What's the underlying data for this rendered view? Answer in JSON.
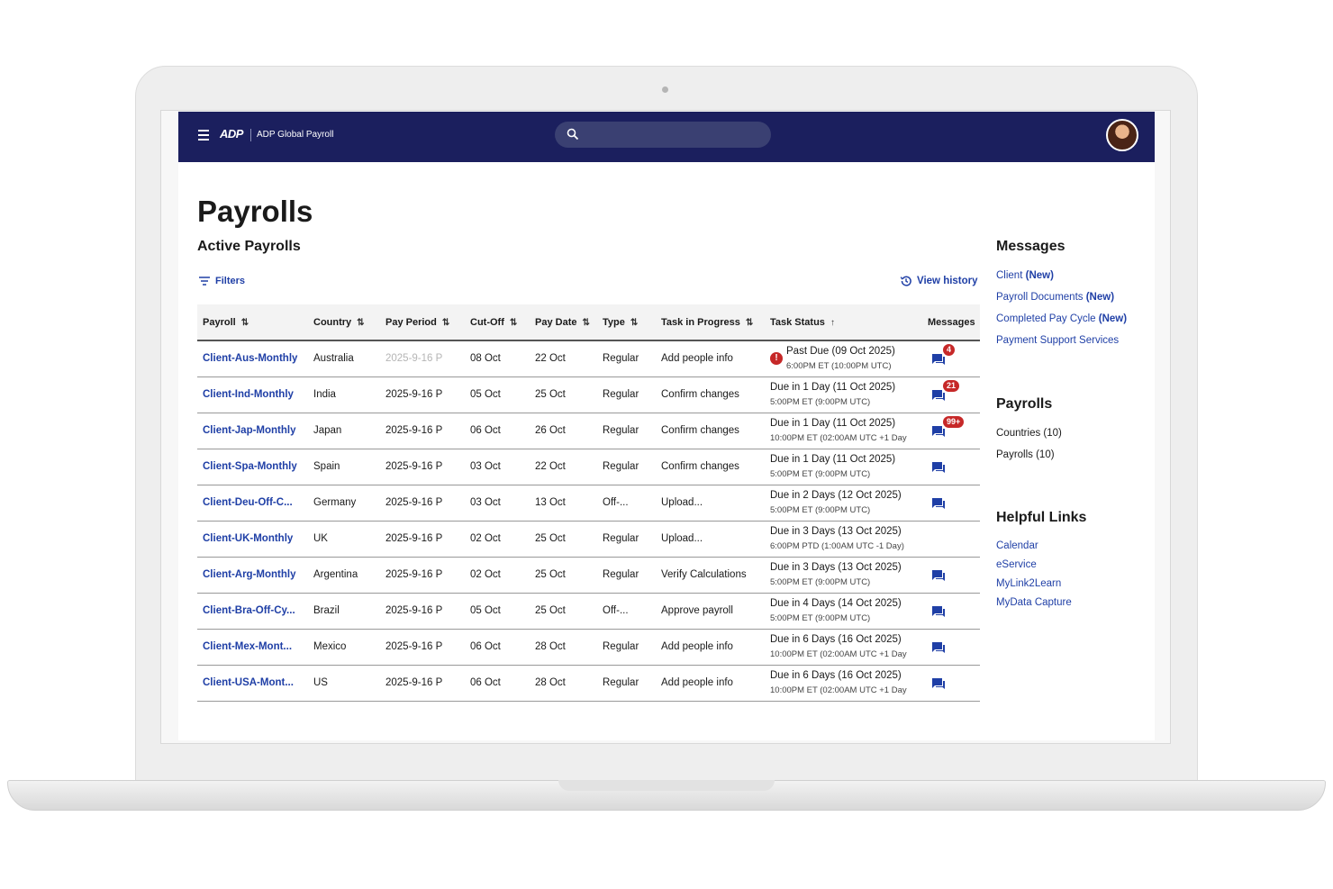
{
  "header": {
    "logo_text": "ADP",
    "app_title": "ADP Global Payroll",
    "search": {
      "placeholder": ""
    }
  },
  "page": {
    "title": "Payrolls",
    "section_title": "Active Payrolls",
    "filters_label": "Filters",
    "view_history_label": "View history"
  },
  "table": {
    "columns": [
      "Payroll",
      "Country",
      "Pay Period",
      "Cut-Off",
      "Pay Date",
      "Type",
      "Task in Progress",
      "Task Status",
      "Messages"
    ],
    "rows": [
      {
        "payroll": "Client-Aus-Monthly",
        "country": "Australia",
        "pay_period": "2025-9-16 P",
        "cut_off": "08 Oct",
        "pay_date": "22 Oct",
        "type": "Regular",
        "task": "Add people info",
        "status": "Past Due (09 Oct 2025)",
        "status_time": "6:00PM ET (10:00PM UTC)",
        "alert": true,
        "messages": "4",
        "has_msg": true,
        "period_muted": true
      },
      {
        "payroll": "Client-Ind-Monthly",
        "country": "India",
        "pay_period": "2025-9-16 P",
        "cut_off": "05 Oct",
        "pay_date": "25 Oct",
        "type": "Regular",
        "task": "Confirm changes",
        "status": "Due in 1 Day (11 Oct 2025)",
        "status_time": "5:00PM ET (9:00PM UTC)",
        "alert": false,
        "messages": "21",
        "has_msg": true
      },
      {
        "payroll": "Client-Jap-Monthly",
        "country": "Japan",
        "pay_period": "2025-9-16 P",
        "cut_off": "06 Oct",
        "pay_date": "26 Oct",
        "type": "Regular",
        "task": "Confirm changes",
        "status": "Due in 1 Day (11 Oct 2025)",
        "status_time": "10:00PM ET (02:00AM UTC +1 Day",
        "alert": false,
        "messages": "99+",
        "has_msg": true
      },
      {
        "payroll": "Client-Spa-Monthly",
        "country": "Spain",
        "pay_period": "2025-9-16 P",
        "cut_off": "03 Oct",
        "pay_date": "22 Oct",
        "type": "Regular",
        "task": "Confirm changes",
        "status": "Due in 1 Day (11 Oct 2025)",
        "status_time": "5:00PM ET (9:00PM UTC)",
        "alert": false,
        "messages": "",
        "has_msg": true
      },
      {
        "payroll": "Client-Deu-Off-C...",
        "country": "Germany",
        "pay_period": "2025-9-16 P",
        "cut_off": "03 Oct",
        "pay_date": "13 Oct",
        "type": "Off-...",
        "task": "Upload...",
        "status": "Due in 2 Days (12 Oct 2025)",
        "status_time": "5:00PM ET (9:00PM UTC)",
        "alert": false,
        "messages": "",
        "has_msg": true
      },
      {
        "payroll": "Client-UK-Monthly",
        "country": "UK",
        "pay_period": "2025-9-16 P",
        "cut_off": "02 Oct",
        "pay_date": "25 Oct",
        "type": "Regular",
        "task": "Upload...",
        "status": "Due in 3 Days (13 Oct 2025)",
        "status_time": "6:00PM PTD (1:00AM UTC -1 Day)",
        "alert": false,
        "messages": "",
        "has_msg": false
      },
      {
        "payroll": "Client-Arg-Monthly",
        "country": "Argentina",
        "pay_period": "2025-9-16 P",
        "cut_off": "02 Oct",
        "pay_date": "25 Oct",
        "type": "Regular",
        "task": "Verify Calculations",
        "status": "Due in 3 Days (13 Oct 2025)",
        "status_time": "5:00PM ET (9:00PM UTC)",
        "alert": false,
        "messages": "",
        "has_msg": true
      },
      {
        "payroll": "Client-Bra-Off-Cy...",
        "country": "Brazil",
        "pay_period": "2025-9-16 P",
        "cut_off": "05 Oct",
        "pay_date": "25 Oct",
        "type": "Off-...",
        "task": "Approve payroll",
        "status": "Due in 4 Days (14 Oct 2025)",
        "status_time": "5:00PM ET (9:00PM UTC)",
        "alert": false,
        "messages": "",
        "has_msg": true
      },
      {
        "payroll": "Client-Mex-Mont...",
        "country": "Mexico",
        "pay_period": "2025-9-16 P",
        "cut_off": "06 Oct",
        "pay_date": "28 Oct",
        "type": "Regular",
        "task": "Add people info",
        "status": "Due in 6 Days (16 Oct 2025)",
        "status_time": "10:00PM ET (02:00AM UTC +1 Day",
        "alert": false,
        "messages": "",
        "has_msg": true
      },
      {
        "payroll": "Client-USA-Mont...",
        "country": "US",
        "pay_period": "2025-9-16 P",
        "cut_off": "06 Oct",
        "pay_date": "28 Oct",
        "type": "Regular",
        "task": "Add people info",
        "status": "Due in 6 Days (16 Oct 2025)",
        "status_time": "10:00PM ET (02:00AM UTC +1 Day",
        "alert": false,
        "messages": "",
        "has_msg": true
      }
    ]
  },
  "sidebar": {
    "messages_title": "Messages",
    "message_links": [
      {
        "text": "Client ",
        "tag": "(New)"
      },
      {
        "text": "Payroll Documents ",
        "tag": "(New)"
      },
      {
        "text": "Completed Pay Cycle ",
        "tag": "(New)"
      },
      {
        "text": "Payment Support Services",
        "tag": ""
      }
    ],
    "payrolls_title": "Payrolls",
    "payrolls_items": [
      "Countries (10)",
      "Payrolls (10)"
    ],
    "helpful_title": "Helpful Links",
    "helpful_links": [
      "Calendar",
      "eService",
      "MyLink2Learn",
      "MyData Capture"
    ]
  },
  "colors": {
    "navbar": "#1b1f5e",
    "link": "#1f3fa6",
    "alert": "#c62828"
  }
}
